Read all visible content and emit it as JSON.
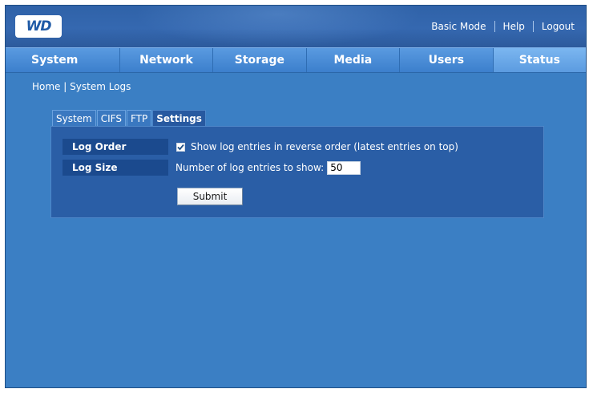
{
  "logo": {
    "text": "WD"
  },
  "header": {
    "links": [
      "Basic Mode",
      "Help",
      "Logout"
    ]
  },
  "nav": {
    "tabs": [
      "System",
      "Network",
      "Storage",
      "Media",
      "Users",
      "Status"
    ],
    "active": "Status"
  },
  "breadcrumb": {
    "home": "Home",
    "separator": "|",
    "current": "System Logs"
  },
  "subtabs": {
    "items": [
      "System",
      "CIFS",
      "FTP",
      "Settings"
    ],
    "active": "Settings"
  },
  "settings": {
    "log_order": {
      "label": "Log Order",
      "checkbox_label": "Show log entries in reverse order (latest entries on top)",
      "checked": true
    },
    "log_size": {
      "label": "Log Size",
      "prompt": "Number of log entries to show:",
      "value": "50"
    },
    "submit_label": "Submit"
  },
  "colors": {
    "background": "#3b7fc4",
    "header": "#2f62a8",
    "panel": "#2a5ea6",
    "label_cell": "#1b4a8e"
  }
}
